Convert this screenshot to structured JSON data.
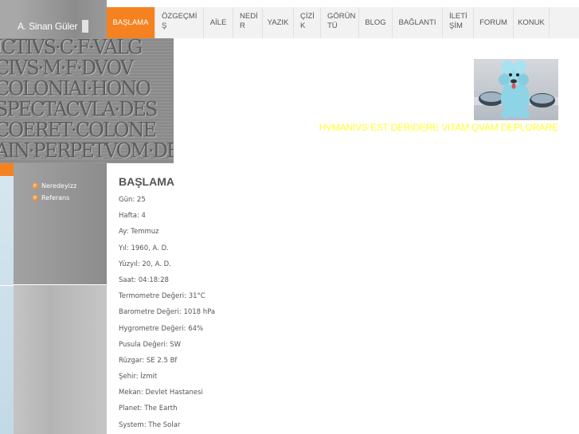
{
  "site": {
    "title": "A. Sinan Güler"
  },
  "nav": [
    {
      "label": "BAŞLAMA",
      "active": true
    },
    {
      "label": "ÖZGEÇMİŞ"
    },
    {
      "label": "AİLE"
    },
    {
      "label": "NEDİR"
    },
    {
      "label": "YAZIK"
    },
    {
      "label": "ÇİZİK"
    },
    {
      "label": "GÖRÜNTÜ"
    },
    {
      "label": "BLOG"
    },
    {
      "label": "BAĞLANTI"
    },
    {
      "label": "İLETİŞİM"
    },
    {
      "label": "FORUM"
    },
    {
      "label": "KONUK"
    }
  ],
  "header": {
    "motto": "HVMANIVS EST DERIDERE VITAM QVAM DEPLORARE",
    "inscription_lines": [
      "ICTIVS·C·F·VALG",
      "CIVS·M·F·DVOV",
      "COLONIAI·HONO",
      "SPECTACVLA·DES",
      "COERET·COLONE",
      "AIN·PERPETVOM·DE"
    ]
  },
  "sidebar": {
    "items": [
      {
        "label": "Neredeyizz"
      },
      {
        "label": "Referans"
      }
    ]
  },
  "main": {
    "title": "BAŞLAMA",
    "rows": [
      "Gün: 25",
      "Hafta: 4",
      "Ay: Temmuz",
      "Yıl: 1960, A. D.",
      "Yüzyıl: 20, A. D.",
      "Saat: 04:18:28",
      "Termometre Değeri: 31°C",
      "Barometre Değeri: 1018 hPa",
      "Hygrometre Değeri: 64%",
      "Pusula Değeri: SW",
      "Rüzgar: SE 2.5 Bf",
      "Şehir: İzmit",
      "Mekan: Devlet Hastanesi",
      "Planet: The Earth",
      "System: The Solar"
    ]
  },
  "colors": {
    "accent": "#f58220",
    "motto": "#ffff33",
    "text": "#555555"
  }
}
